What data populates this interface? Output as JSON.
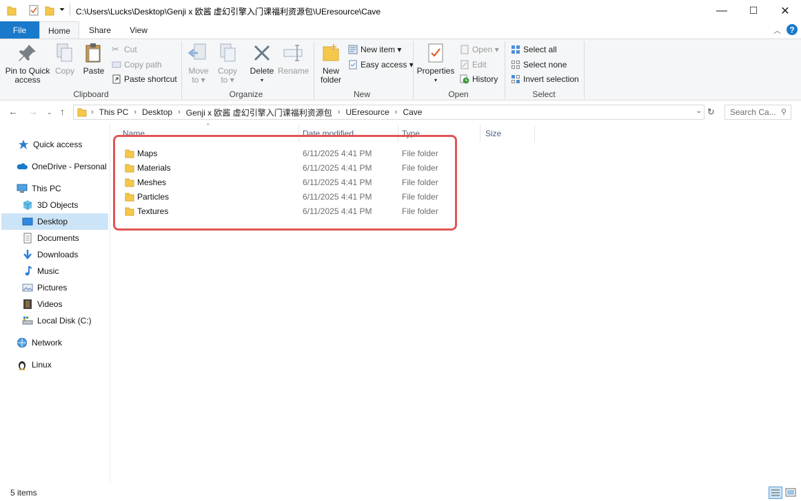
{
  "window": {
    "path": "C:\\Users\\Lucks\\Desktop\\Genji x 欧酱 虚幻引擎入门课福利资源包\\UEresource\\Cave",
    "minimize": "—",
    "maximize": "☐",
    "close": "✕"
  },
  "tabs": {
    "file": "File",
    "home": "Home",
    "share": "Share",
    "view": "View"
  },
  "ribbon": {
    "pin": [
      "Pin to Quick",
      "access"
    ],
    "copy": "Copy",
    "paste": "Paste",
    "cut": "Cut",
    "copy_path": "Copy path",
    "paste_shortcut": "Paste shortcut",
    "clipboard": "Clipboard",
    "move_to": [
      "Move",
      "to ▾"
    ],
    "copy_to": [
      "Copy",
      "to ▾"
    ],
    "delete": [
      "Delete",
      "▾"
    ],
    "rename": "Rename",
    "organize": "Organize",
    "new_folder": [
      "New",
      "folder"
    ],
    "new_item": "New item ▾",
    "easy_access": "Easy access ▾",
    "new": "New",
    "properties": [
      "Properties",
      "▾"
    ],
    "open": "Open ▾",
    "edit": "Edit",
    "history": "History",
    "open_group": "Open",
    "select_all": "Select all",
    "select_none": "Select none",
    "invert_selection": "Invert selection",
    "select": "Select"
  },
  "address": {
    "crumbs": [
      "This PC",
      "Desktop",
      "Genji x 欧酱 虚幻引擎入门课福利资源包",
      "UEresource",
      "Cave"
    ],
    "search_placeholder": "Search Ca..."
  },
  "nav": {
    "quick_access": "Quick access",
    "onedrive": "OneDrive - Personal",
    "this_pc": "This PC",
    "objects3d": "3D Objects",
    "desktop": "Desktop",
    "documents": "Documents",
    "downloads": "Downloads",
    "music": "Music",
    "pictures": "Pictures",
    "videos": "Videos",
    "local_disk": "Local Disk (C:)",
    "network": "Network",
    "linux": "Linux"
  },
  "columns": {
    "name": "Name",
    "date": "Date modified",
    "type": "Type",
    "size": "Size"
  },
  "files": [
    {
      "name": "Maps",
      "date": "6/11/2025 4:41 PM",
      "type": "File folder"
    },
    {
      "name": "Materials",
      "date": "6/11/2025 4:41 PM",
      "type": "File folder"
    },
    {
      "name": "Meshes",
      "date": "6/11/2025 4:41 PM",
      "type": "File folder"
    },
    {
      "name": "Particles",
      "date": "6/11/2025 4:41 PM",
      "type": "File folder"
    },
    {
      "name": "Textures",
      "date": "6/11/2025 4:41 PM",
      "type": "File folder"
    }
  ],
  "status": {
    "items": "5 items"
  },
  "colors": {
    "accent": "#1979ca",
    "highlight_border": "#e05555",
    "selected_bg": "#cce4f7",
    "folder": "#f5c84c"
  }
}
